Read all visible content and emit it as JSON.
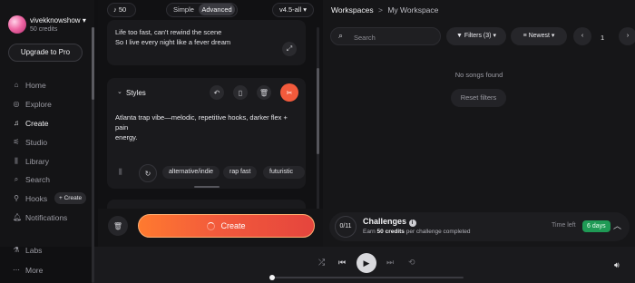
{
  "user": {
    "name": "vivekknowshow",
    "credits": "50 credits"
  },
  "sidebar": {
    "upgrade_label": "Upgrade to Pro",
    "items": [
      {
        "label": "Home",
        "icon": "home-icon"
      },
      {
        "label": "Explore",
        "icon": "compass-icon"
      },
      {
        "label": "Create",
        "icon": "music-note-icon"
      },
      {
        "label": "Studio",
        "icon": "studio-icon"
      },
      {
        "label": "Library",
        "icon": "library-icon"
      },
      {
        "label": "Search",
        "icon": "search-icon"
      },
      {
        "label": "Hooks",
        "icon": "hooks-icon"
      },
      {
        "label": "Notifications",
        "icon": "bell-icon"
      },
      {
        "label": "Labs",
        "icon": "flask-icon"
      },
      {
        "label": "More",
        "icon": "ellipsis-icon"
      }
    ],
    "hooks_create_label": "+ Create"
  },
  "create_panel": {
    "credits_count": "50",
    "mode_simple": "Simple",
    "mode_advanced": "Advanced",
    "model_label": "v4.5-all",
    "lyrics": [
      "Life too fast, can't rewind the scene",
      "So I live every night like a fever dream"
    ],
    "styles_title": "Styles",
    "styles_text_line1": "Atlanta trap vibe—melodic, repetitive hooks, darker flex + pain",
    "styles_text_line2": "energy.",
    "tags": [
      "alternative/indie",
      "rap fast",
      "futuristic"
    ],
    "create_label": "Create"
  },
  "workspace": {
    "breadcrumb_root": "Workspaces",
    "breadcrumb_sep": ">",
    "breadcrumb_current": "My Workspace",
    "search_placeholder": "Search",
    "filters_label": "Filters (3)",
    "sort_label": "Newest",
    "page_number": "1",
    "empty_message": "No songs found",
    "reset_label": "Reset filters"
  },
  "challenges": {
    "progress": "0/11",
    "title": "Challenges",
    "desc_prefix": "Earn ",
    "desc_bold": "50 credits",
    "desc_suffix": " per challenge completed",
    "time_left_label": "Time left",
    "time_left_value": "6 days"
  },
  "player": {
    "progress_fraction": 0.0
  },
  "colors": {
    "accent_orange": "#f25a3c",
    "time_badge_green": "#1f9a55"
  }
}
